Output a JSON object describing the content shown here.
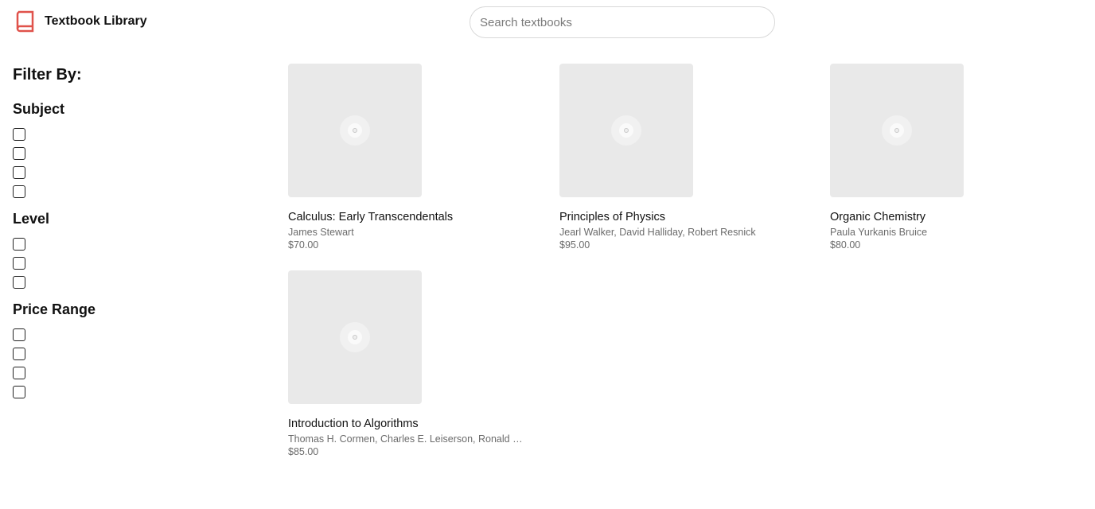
{
  "header": {
    "app_title": "Textbook Library",
    "search_placeholder": "Search textbooks",
    "search_value": "",
    "brand_color": "#e0524b",
    "logo_icon": "book-icon"
  },
  "sidebar": {
    "heading": "Filter By:",
    "groups": [
      {
        "title": "Subject",
        "checkbox_count": 4
      },
      {
        "title": "Level",
        "checkbox_count": 3
      },
      {
        "title": "Price Range",
        "checkbox_count": 4
      }
    ]
  },
  "books": [
    {
      "title": "Calculus: Early Transcendentals",
      "author": "James Stewart",
      "price": "$70.00"
    },
    {
      "title": "Principles of Physics",
      "author": "Jearl Walker, David Halliday, Robert Resnick",
      "price": "$95.00"
    },
    {
      "title": "Organic Chemistry",
      "author": "Paula Yurkanis Bruice",
      "price": "$80.00"
    },
    {
      "title": "Introduction to Algorithms",
      "author": "Thomas H. Cormen, Charles E. Leiserson, Ronald L....",
      "price": "$85.00"
    }
  ]
}
